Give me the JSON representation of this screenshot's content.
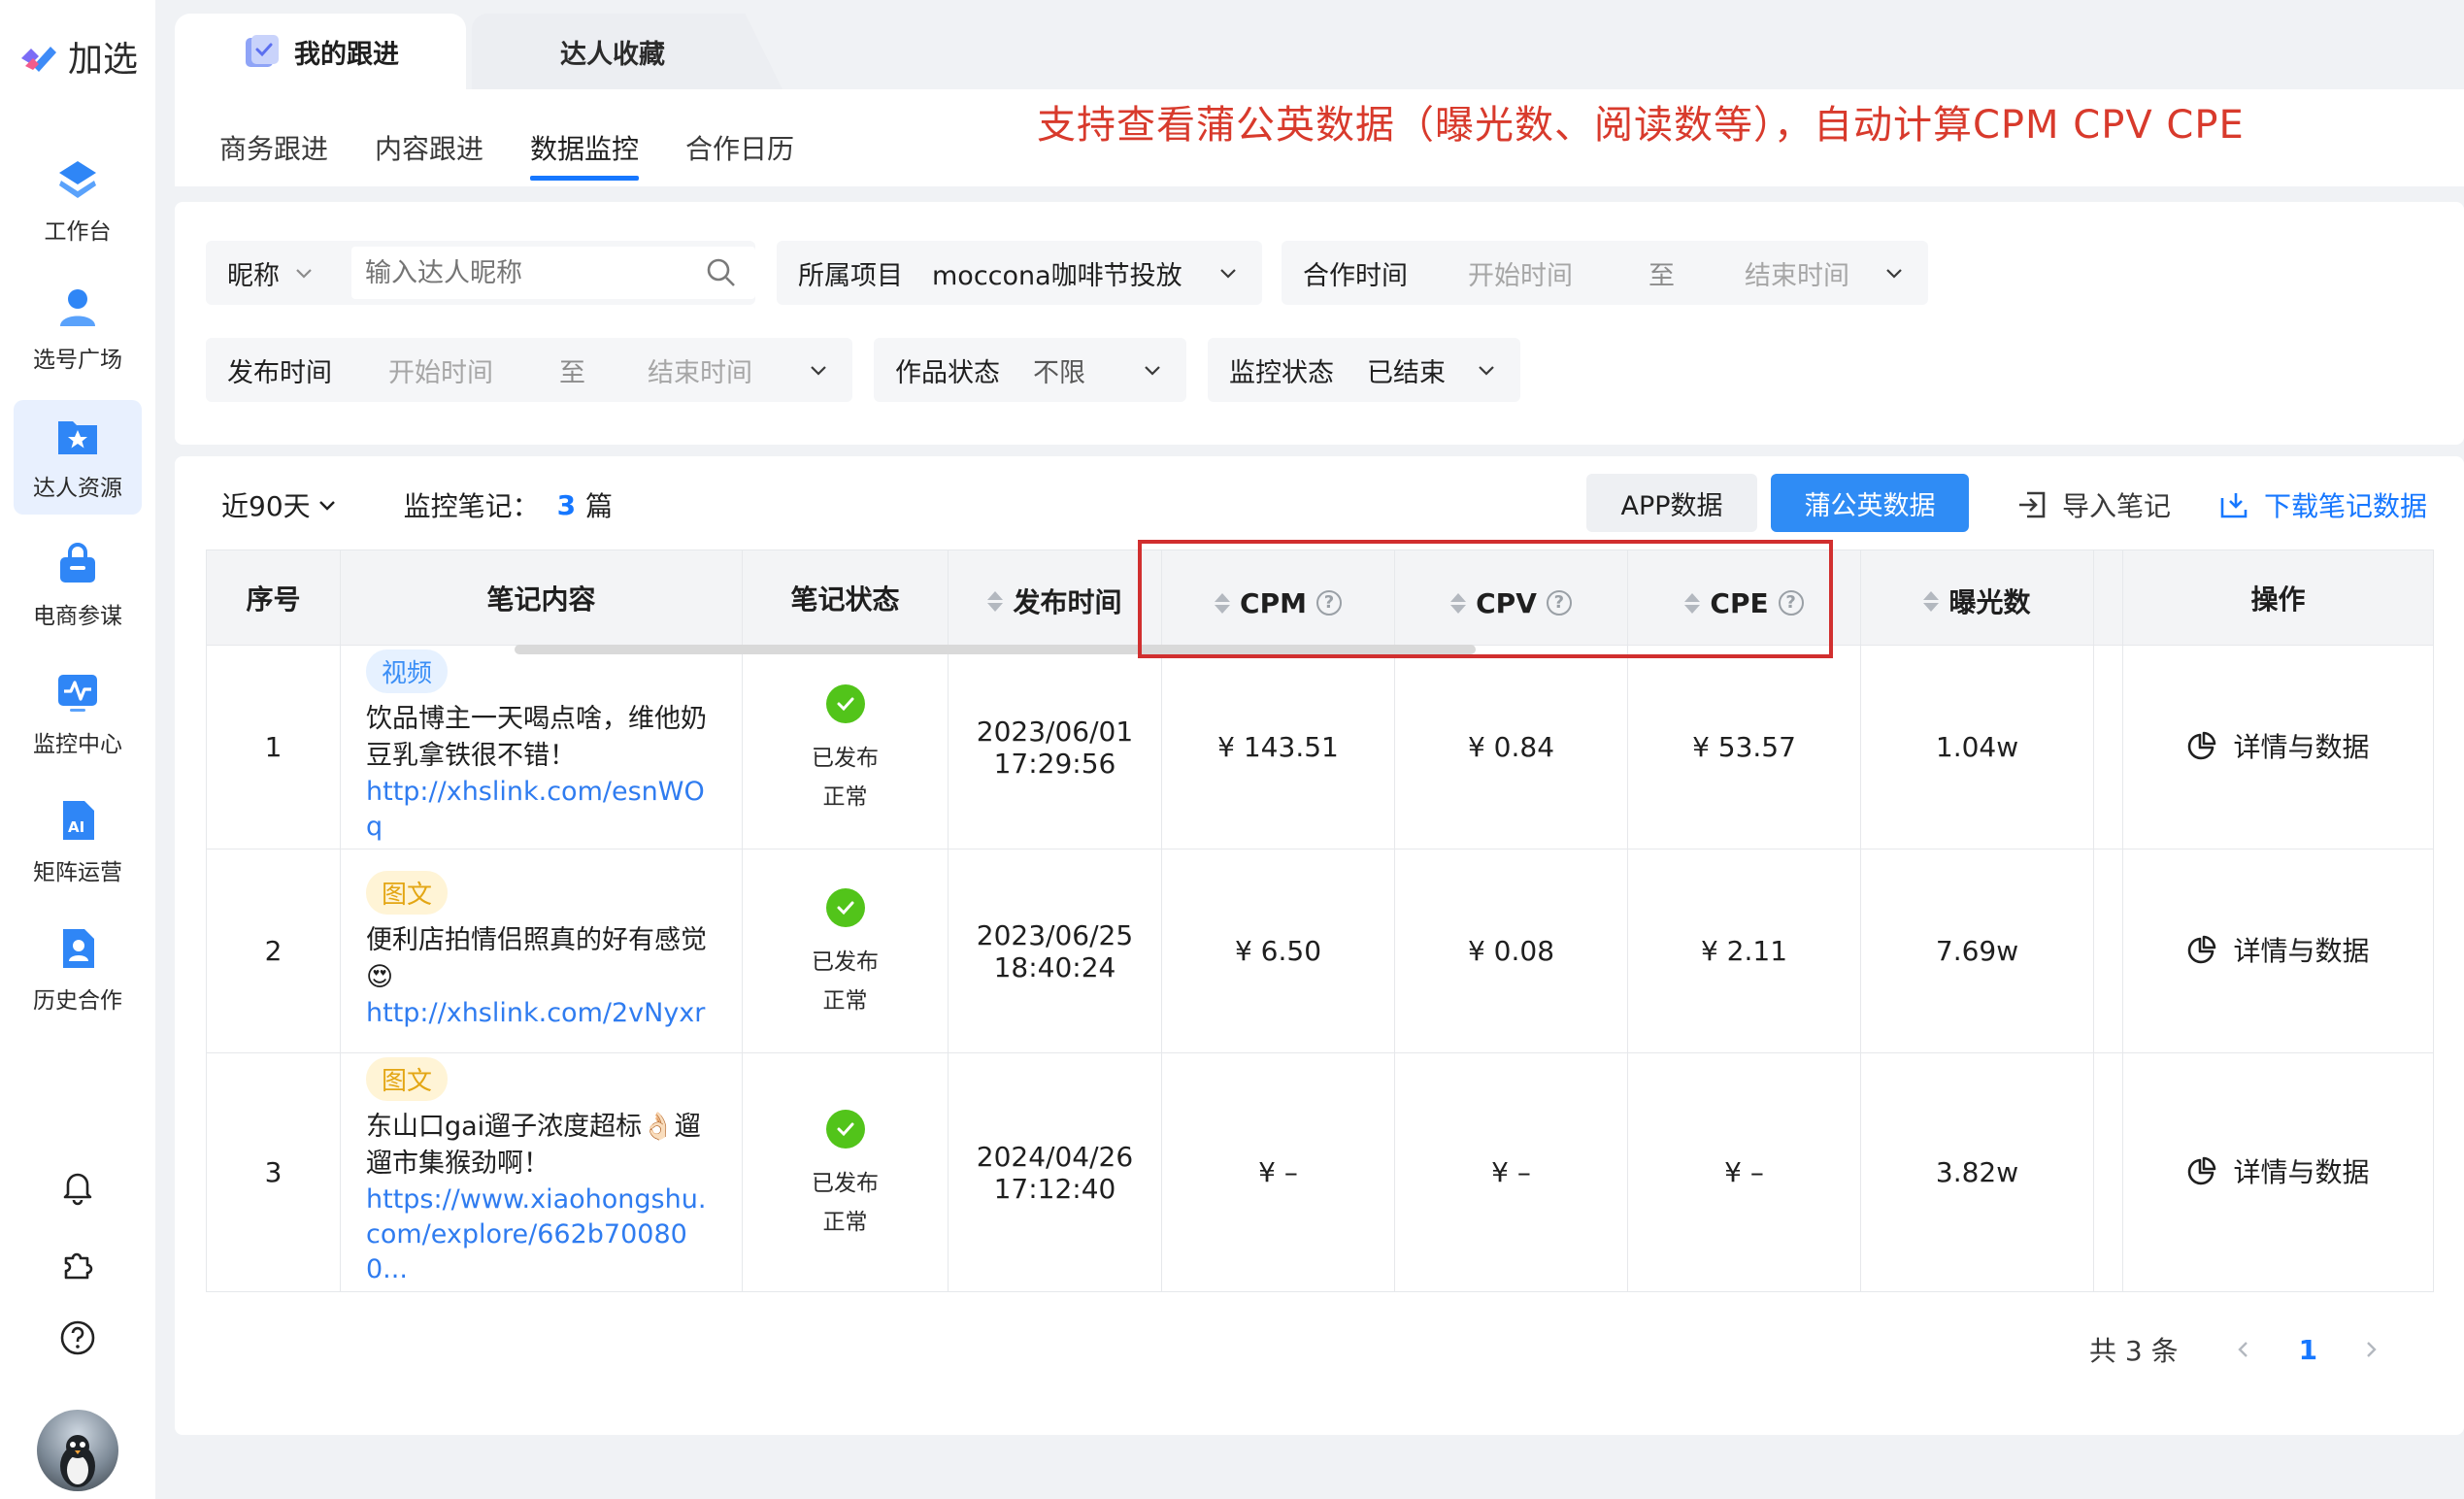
{
  "brand": {
    "logo_text": "加选"
  },
  "sidebar": {
    "items": [
      {
        "label": "工作台",
        "icon": "layers-icon"
      },
      {
        "label": "选号广场",
        "icon": "user-icon"
      },
      {
        "label": "达人资源",
        "icon": "star-folder-icon"
      },
      {
        "label": "电商参谋",
        "icon": "shopping-bag-icon"
      },
      {
        "label": "监控中心",
        "icon": "monitor-pulse-icon"
      },
      {
        "label": "矩阵运营",
        "icon": "ai-doc-icon"
      },
      {
        "label": "历史合作",
        "icon": "history-doc-icon"
      }
    ],
    "active_index": 2
  },
  "top_tabs": [
    {
      "label": "我的跟进"
    },
    {
      "label": "达人收藏"
    }
  ],
  "sub_tabs": [
    {
      "label": "商务跟进"
    },
    {
      "label": "内容跟进"
    },
    {
      "label": "数据监控"
    },
    {
      "label": "合作日历"
    }
  ],
  "annotation": "支持查看蒲公英数据（曝光数、阅读数等），自动计算CPM CPV CPE",
  "filters": {
    "nickname": {
      "label": "昵称",
      "placeholder": "输入达人昵称"
    },
    "project": {
      "label": "所属项目",
      "value": "moccona咖啡节投放"
    },
    "coop_time": {
      "label": "合作时间",
      "start": "开始时间",
      "sep": "至",
      "end": "结束时间"
    },
    "publish_time": {
      "label": "发布时间",
      "start": "开始时间",
      "sep": "至",
      "end": "结束时间"
    },
    "work_status": {
      "label": "作品状态",
      "value": "不限"
    },
    "monitor_status": {
      "label": "监控状态",
      "value": "已结束"
    }
  },
  "toolbar": {
    "range": "近90天",
    "monitor_label": "监控笔记：",
    "monitor_count": "3",
    "monitor_unit": "篇",
    "app_data": "APP数据",
    "pgy_data": "蒲公英数据",
    "import": "导入笔记",
    "download": "下载笔记数据"
  },
  "table": {
    "headers": {
      "index": "序号",
      "note": "笔记内容",
      "status": "笔记状态",
      "publish": "发布时间",
      "cpm": "CPM",
      "cpv": "CPV",
      "cpe": "CPE",
      "exposure": "曝光数",
      "ops": "操作"
    },
    "rows": [
      {
        "index": "1",
        "tag": "视频",
        "title": "饮品博主一天喝点啥，维他奶豆乳拿铁很不错！",
        "link": "http://xhslink.com/esnWOq",
        "status1": "已发布",
        "status2": "正常",
        "date": "2023/06/01",
        "time": "17:29:56",
        "cpm": "¥  143.51",
        "cpv": "¥  0.84",
        "cpe": "¥ 53.57",
        "exposure": "1.04w",
        "op": "详情与数据"
      },
      {
        "index": "2",
        "tag": "图文",
        "title": "便利店拍情侣照真的好有感觉😍",
        "link": "http://xhslink.com/2vNyxr",
        "status1": "已发布",
        "status2": "正常",
        "date": "2023/06/25",
        "time": "18:40:24",
        "cpm": "¥  6.50",
        "cpv": "¥  0.08",
        "cpe": "¥ 2.11",
        "exposure": "7.69w",
        "op": "详情与数据"
      },
      {
        "index": "3",
        "tag": "图文",
        "title": "东山口gai遛子浓度超标👌🏻遛遛市集猴劲啊！",
        "link": "https://www.xiaohongshu.com/explore/662b700800...",
        "status1": "已发布",
        "status2": "正常",
        "date": "2024/04/26",
        "time": "17:12:40",
        "cpm": "¥  –",
        "cpv": "¥  –",
        "cpe": "¥ –",
        "exposure": "3.82w",
        "op": "详情与数据"
      }
    ]
  },
  "pagination": {
    "total": "共 3 条",
    "current": "1"
  },
  "colors": {
    "primary": "#1677ff",
    "annotation": "#d83a2c",
    "success": "#52c41a"
  }
}
